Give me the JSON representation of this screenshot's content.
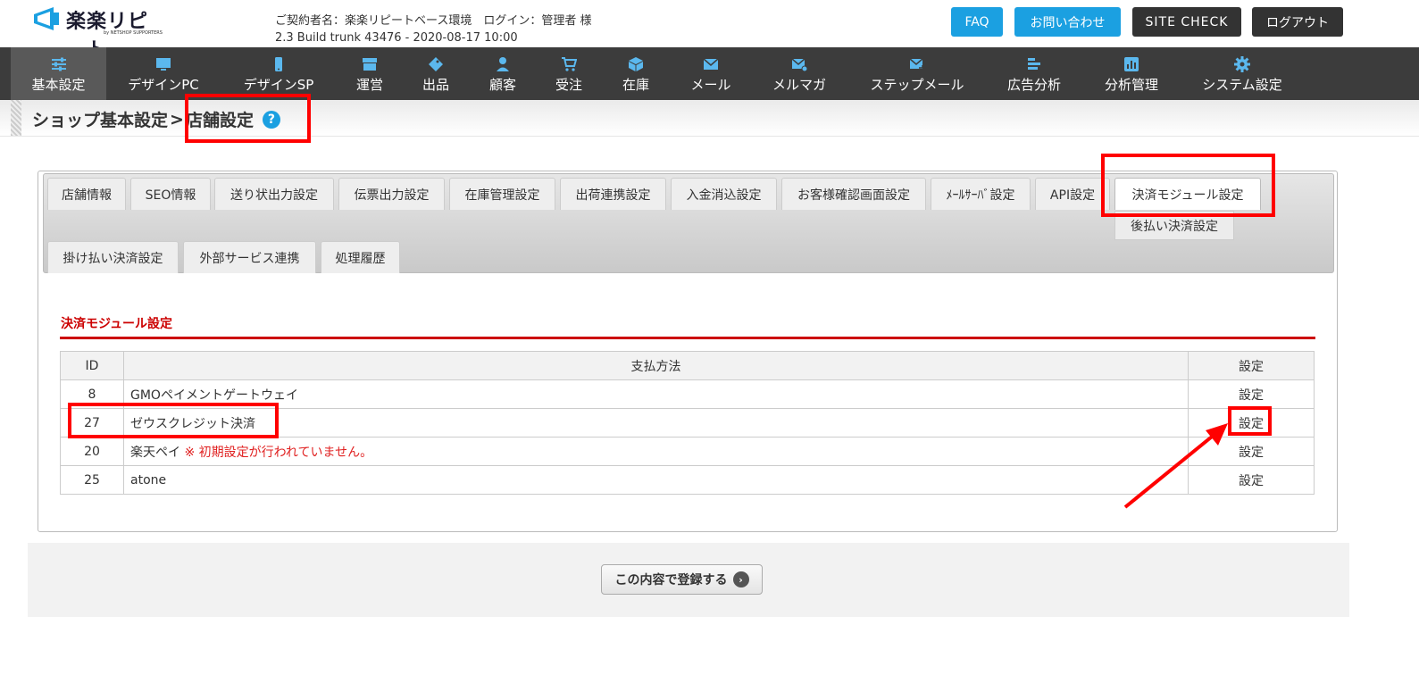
{
  "header": {
    "logo_text": "楽楽リピート",
    "logo_sub": "by NETSHOP SUPPORTERS",
    "contract_line": "ご契約者名：楽楽リピートベース環境　ログイン：管理者 様",
    "build_line": "2.3 Build trunk 43476 - 2020-08-17 10:00",
    "buttons": {
      "faq": "FAQ",
      "contact": "お問い合わせ",
      "site_check": "SITE CHECK",
      "logout": "ログアウト"
    }
  },
  "nav": {
    "items": [
      {
        "label": "基本設定",
        "icon": "sliders-icon"
      },
      {
        "label": "デザインPC",
        "icon": "monitor-icon"
      },
      {
        "label": "デザインSP",
        "icon": "smartphone-icon"
      },
      {
        "label": "運営",
        "icon": "store-icon"
      },
      {
        "label": "出品",
        "icon": "tag-icon"
      },
      {
        "label": "顧客",
        "icon": "user-icon"
      },
      {
        "label": "受注",
        "icon": "cart-icon"
      },
      {
        "label": "在庫",
        "icon": "box-icon"
      },
      {
        "label": "メール",
        "icon": "mail-icon"
      },
      {
        "label": "メルマガ",
        "icon": "newsletter-icon"
      },
      {
        "label": "ステップメール",
        "icon": "step-mail-icon"
      },
      {
        "label": "広告分析",
        "icon": "bars-icon"
      },
      {
        "label": "分析管理",
        "icon": "chart-icon"
      },
      {
        "label": "システム設定",
        "icon": "gear-icon"
      }
    ]
  },
  "breadcrumb": {
    "parent": "ショップ基本設定",
    "separator": ">",
    "current": "店舗設定",
    "help": "?"
  },
  "tabs": {
    "row1": [
      "店舗情報",
      "SEO情報",
      "送り状出力設定",
      "伝票出力設定",
      "在庫管理設定",
      "出荷連携設定",
      "入金消込設定",
      "お客様確認画面設定",
      "ﾒｰﾙｻｰﾊﾞ設定",
      "API設定",
      "決済モジュール設定"
    ],
    "row2": [
      "掛け払い決済設定",
      "外部サービス連携",
      "処理履歴"
    ],
    "subtab": "後払い決済設定"
  },
  "section": {
    "title": "決済モジュール設定"
  },
  "table": {
    "headers": {
      "id": "ID",
      "method": "支払方法",
      "setting": "設定"
    },
    "rows": [
      {
        "id": "8",
        "method": "GMOペイメントゲートウェイ",
        "warning": "",
        "setting": "設定"
      },
      {
        "id": "27",
        "method": "ゼウスクレジット決済",
        "warning": "",
        "setting": "設定"
      },
      {
        "id": "20",
        "method": "楽天ペイ",
        "warning": "※ 初期設定が行われていません。",
        "setting": "設定"
      },
      {
        "id": "25",
        "method": "atone",
        "warning": "",
        "setting": "設定"
      }
    ]
  },
  "footer": {
    "save_label": "この内容で登録する",
    "save_arrow": "›"
  },
  "colors": {
    "accent_blue": "#1ba0e1",
    "nav_bg": "#3c3c3c",
    "annotation_red": "#ff0000",
    "section_red": "#cc0000"
  }
}
